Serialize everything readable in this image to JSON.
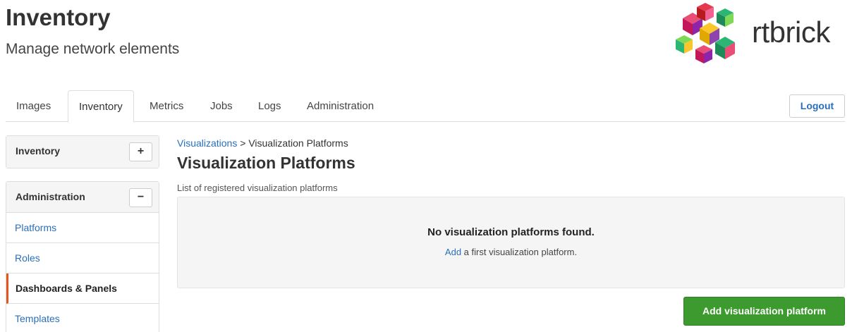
{
  "header": {
    "title": "Inventory",
    "subtitle": "Manage network elements",
    "logo_text": "rtbrick"
  },
  "nav": {
    "tabs": [
      {
        "label": "Images"
      },
      {
        "label": "Inventory",
        "active": true
      },
      {
        "label": "Metrics"
      },
      {
        "label": "Jobs"
      },
      {
        "label": "Logs"
      },
      {
        "label": "Administration"
      }
    ],
    "logout_label": "Logout"
  },
  "sidebar": {
    "inventory_panel": {
      "title": "Inventory",
      "toggle": "+"
    },
    "admin_panel": {
      "title": "Administration",
      "toggle": "−",
      "items": [
        {
          "label": "Platforms"
        },
        {
          "label": "Roles"
        },
        {
          "label": "Dashboards & Panels",
          "active": true
        },
        {
          "label": "Templates"
        }
      ]
    }
  },
  "main": {
    "breadcrumb": {
      "link": "Visualizations",
      "separator": " > ",
      "current": "Visualization Platforms"
    },
    "title": "Visualization Platforms",
    "description": "List of registered visualization platforms",
    "empty": {
      "title": "No visualization platforms found.",
      "hint_link": "Add",
      "hint_text": " a first visualization platform."
    },
    "add_button": "Add visualization platform"
  },
  "colors": {
    "link": "#2a6ebb",
    "primary_button": "#3c9a2f",
    "active_indicator": "#e2571e"
  }
}
